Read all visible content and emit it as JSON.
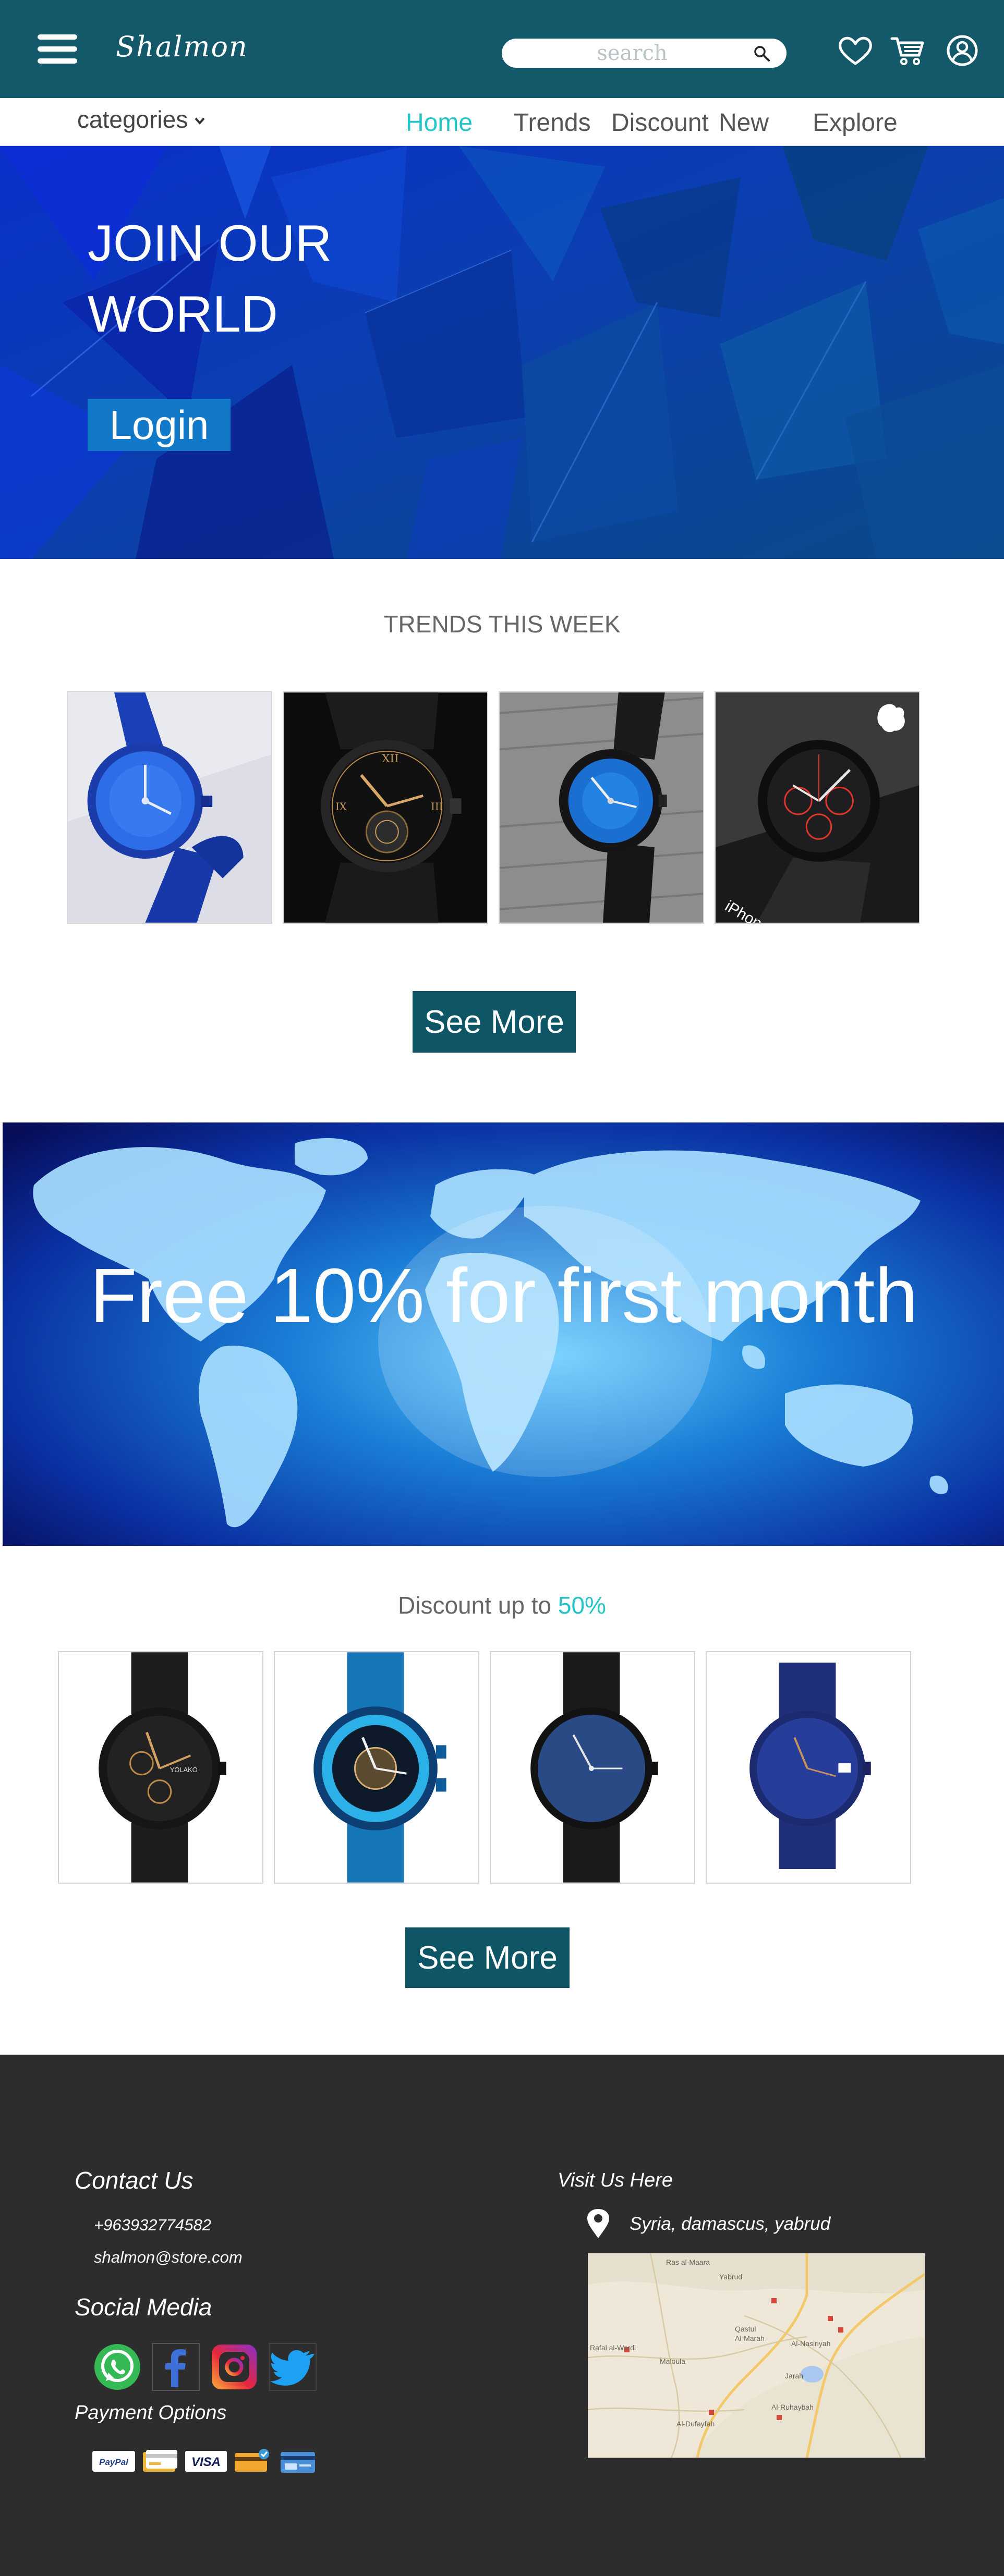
{
  "header": {
    "brand": "Shalmon",
    "search_placeholder": "search",
    "icons": [
      "menu-icon",
      "search-icon",
      "heart-icon",
      "cart-icon",
      "user-icon"
    ],
    "bg_color": "#13596a"
  },
  "nav": {
    "categories_label": "categories",
    "links": [
      "Home",
      "Trends",
      "Discount",
      "New",
      "Explore"
    ],
    "active": "Home",
    "active_color": "#23c6c8"
  },
  "hero": {
    "title_line1": "JOIN OUR",
    "title_line2": "WORLD",
    "login_label": "Login"
  },
  "trends": {
    "title": "TRENDS THIS WEEK",
    "products": [
      "blue-mesh-watch",
      "black-skeleton-watch",
      "black-blue-dial-watch",
      "black-red-chrono-watch"
    ],
    "photo_caption": "iPhone",
    "see_more_label": "See More"
  },
  "promo": {
    "text": "Free 10% for first month"
  },
  "discount": {
    "title_prefix": "Discount up to",
    "title_value": "50%",
    "brand_on_dial": "YOLAKO",
    "products": [
      "black-chrono-watch",
      "blue-skeleton-watch",
      "black-minimal-watch",
      "navy-minimal-watch"
    ],
    "see_more_label": "See More"
  },
  "footer": {
    "contact_title": "Contact Us",
    "phone": "+963932774582",
    "email": "shalmon@store.com",
    "social_title": "Social Media",
    "social": [
      "whatsapp-icon",
      "facebook-icon",
      "instagram-icon",
      "twitter-icon"
    ],
    "payment_title": "Payment Options",
    "payments": [
      "paypal-icon",
      "card-icon",
      "visa-icon",
      "mastercard-icon",
      "bank-card-icon"
    ],
    "paypal_label": "PayPal",
    "visa_label": "VISA",
    "visit_title": "Visit Us Here",
    "address": "Syria, damascus, yabrud",
    "map_labels": [
      "Ras al-Maara",
      "Yabrud",
      "Qastul",
      "Al-Marah",
      "Al-Nasiriyah",
      "Maloula",
      "Jarah",
      "Al-Ruhaybah",
      "Al-Dufayfah",
      "Rafal al-Wardi"
    ]
  }
}
